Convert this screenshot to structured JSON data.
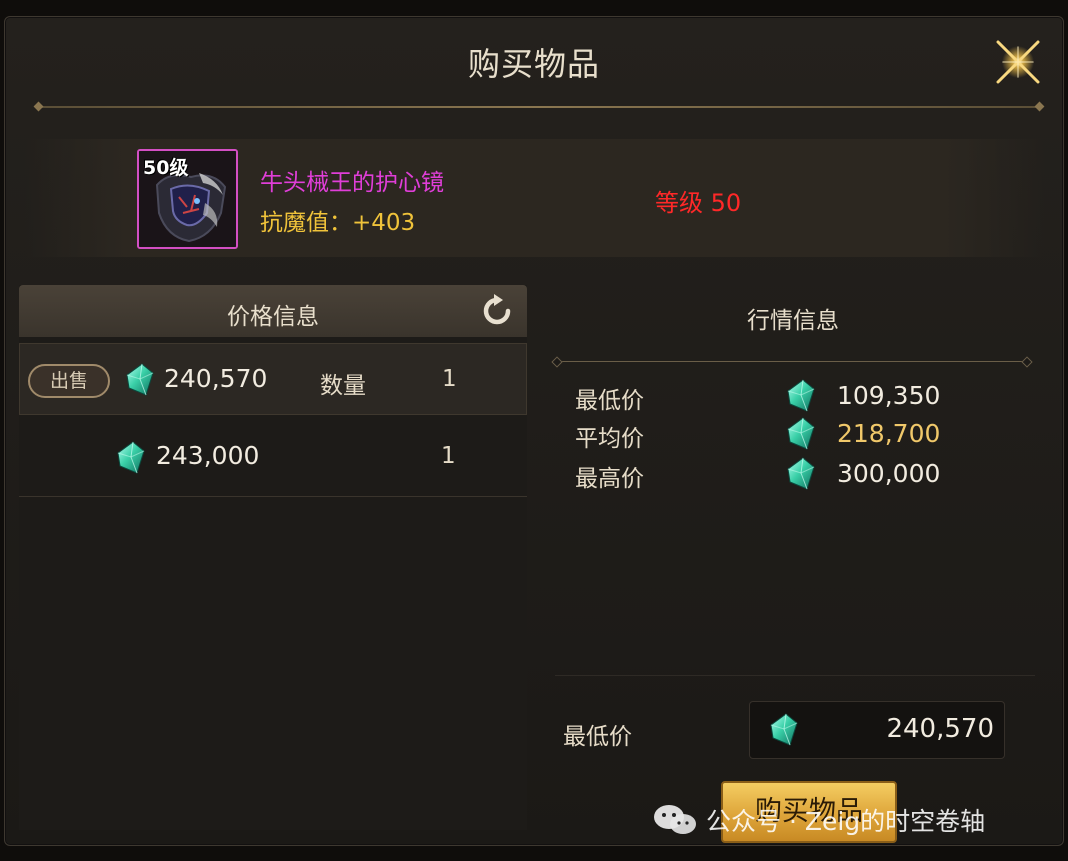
{
  "window": {
    "title": "购买物品"
  },
  "item": {
    "level_tag": "50级",
    "name": "牛头械王的护心镜",
    "stat": "抗魔值：+403",
    "level_text": "等级 50",
    "name_color": "#e03ed8",
    "rarity_border_color": "#d34fc4"
  },
  "price_panel": {
    "header": "价格信息",
    "listings": [
      {
        "badge": "出售",
        "price": "240,570",
        "qty_label": "数量",
        "qty": "1"
      },
      {
        "price": "243,000",
        "qty": "1"
      }
    ]
  },
  "market_panel": {
    "title": "行情信息",
    "stats": [
      {
        "label": "最低价",
        "value": "109,350"
      },
      {
        "label": "平均价",
        "value": "218,700"
      },
      {
        "label": "最高价",
        "value": "300,000"
      }
    ],
    "min_price_label": "最低价",
    "min_price_value": "240,570",
    "buy_button": "购买物品"
  },
  "watermark": {
    "text": "公众号 · Zeig的时空卷轴"
  },
  "icons": {
    "currency": "gem-icon",
    "refresh": "refresh-icon",
    "close": "close-icon",
    "wechat": "wechat-icon"
  },
  "colors": {
    "accent_gold": "#f0c33a",
    "level_red": "#ff2828",
    "avg_price": "#f0c86a",
    "gem": "#3ad0a8"
  }
}
